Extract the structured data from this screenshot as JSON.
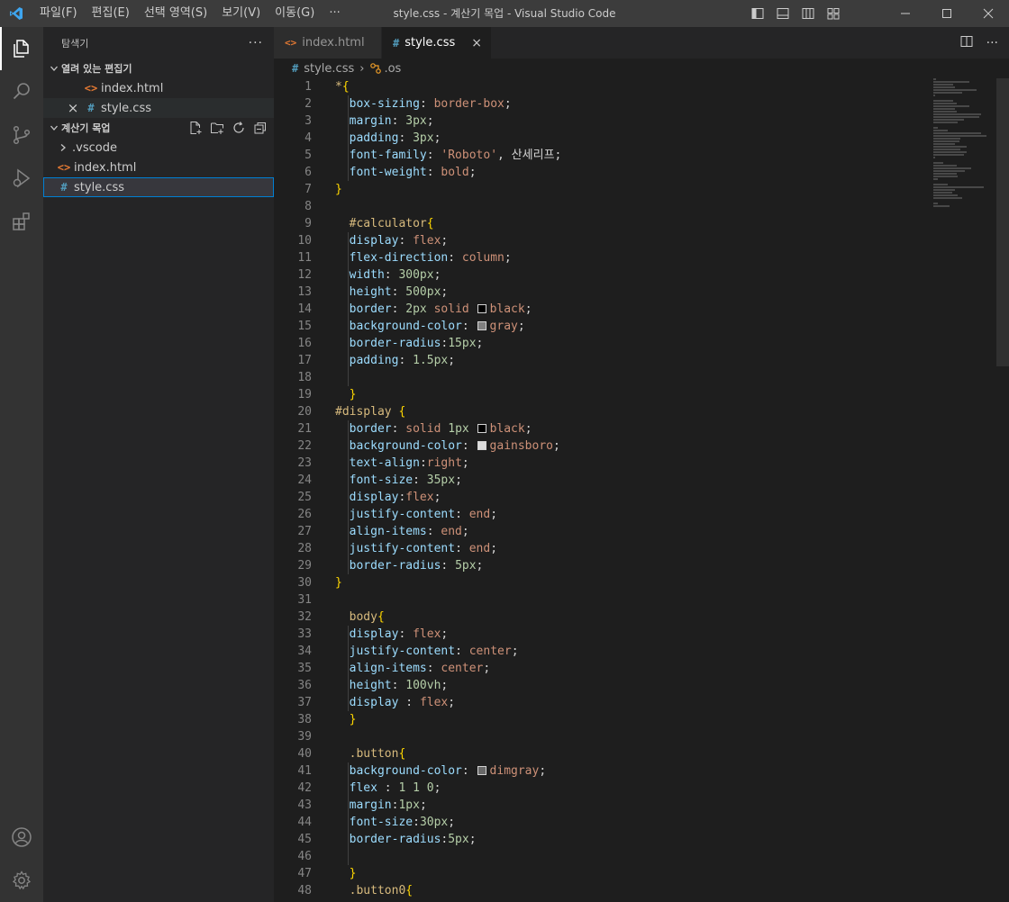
{
  "titlebar": {
    "menu": [
      "파일(F)",
      "편집(E)",
      "선택 영역(S)",
      "보기(V)",
      "이동(G)",
      "···"
    ],
    "title": "style.css - 계산기 목업 - Visual Studio Code"
  },
  "sidebar": {
    "title": "탐색기",
    "more": "···",
    "open_editors": {
      "title": "열려 있는 편집기",
      "items": [
        {
          "icon": "<>",
          "label": "index.html"
        },
        {
          "close": "×",
          "icon": "#",
          "label": "style.css"
        }
      ]
    },
    "project": {
      "title": "계산기 목업",
      "items": [
        {
          "chev": "›",
          "label": ".vscode"
        },
        {
          "icon": "<>",
          "label": "index.html"
        },
        {
          "icon": "#",
          "label": "style.css"
        }
      ]
    }
  },
  "tabs": [
    {
      "icon": "<>",
      "label": "index.html"
    },
    {
      "icon": "#",
      "label": "style.css",
      "close": "×"
    }
  ],
  "tab_actions": [
    "⫴",
    "···"
  ],
  "breadcrumb": {
    "file_icon": "#",
    "file": "style.css",
    "sep": "›",
    "symbol": ".os"
  },
  "colors": {
    "accent": "#007acc",
    "html": "#e37933",
    "css": "#519aba",
    "selector": "#d7ba7d",
    "property": "#9cdcfe",
    "value": "#ce9178",
    "number": "#b5cea8",
    "brace": "#ffd700"
  },
  "code_lines": [
    [
      [
        "tk-sel",
        "*"
      ],
      [
        "tk-brace",
        "{"
      ]
    ],
    [
      [
        "",
        "  "
      ],
      [
        "tk-prop",
        "box-sizing"
      ],
      [
        "tk-pun",
        ": "
      ],
      [
        "tk-val",
        "border-box"
      ],
      [
        "tk-pun",
        ";"
      ]
    ],
    [
      [
        "",
        "  "
      ],
      [
        "tk-prop",
        "margin"
      ],
      [
        "tk-pun",
        ": "
      ],
      [
        "tk-num",
        "3px"
      ],
      [
        "tk-pun",
        ";"
      ]
    ],
    [
      [
        "",
        "  "
      ],
      [
        "tk-prop",
        "padding"
      ],
      [
        "tk-pun",
        ": "
      ],
      [
        "tk-num",
        "3px"
      ],
      [
        "tk-pun",
        ";"
      ]
    ],
    [
      [
        "",
        "  "
      ],
      [
        "tk-prop",
        "font-family"
      ],
      [
        "tk-pun",
        ": "
      ],
      [
        "tk-val",
        "'Roboto'"
      ],
      [
        "tk-pun",
        ", 산세리프;"
      ]
    ],
    [
      [
        "",
        "  "
      ],
      [
        "tk-prop",
        "font-weight"
      ],
      [
        "tk-pun",
        ": "
      ],
      [
        "tk-val",
        "bold"
      ],
      [
        "tk-pun",
        ";"
      ]
    ],
    [
      [
        "tk-brace",
        "}"
      ]
    ],
    [],
    [
      [
        "",
        "  "
      ],
      [
        "tk-sel",
        "#calculator"
      ],
      [
        "tk-brace",
        "{"
      ]
    ],
    [
      [
        "",
        "  "
      ],
      [
        "tk-prop",
        "display"
      ],
      [
        "tk-pun",
        ": "
      ],
      [
        "tk-val",
        "flex"
      ],
      [
        "tk-pun",
        ";"
      ]
    ],
    [
      [
        "",
        "  "
      ],
      [
        "tk-prop",
        "flex-direction"
      ],
      [
        "tk-pun",
        ": "
      ],
      [
        "tk-val",
        "column"
      ],
      [
        "tk-pun",
        ";"
      ]
    ],
    [
      [
        "",
        "  "
      ],
      [
        "tk-prop",
        "width"
      ],
      [
        "tk-pun",
        ": "
      ],
      [
        "tk-num",
        "300px"
      ],
      [
        "tk-pun",
        ";"
      ]
    ],
    [
      [
        "",
        "  "
      ],
      [
        "tk-prop",
        "height"
      ],
      [
        "tk-pun",
        ": "
      ],
      [
        "tk-num",
        "500px"
      ],
      [
        "tk-pun",
        ";"
      ]
    ],
    [
      [
        "",
        "  "
      ],
      [
        "tk-prop",
        "border"
      ],
      [
        "tk-pun",
        ": "
      ],
      [
        "tk-num",
        "2px"
      ],
      [
        "tk-pun",
        " "
      ],
      [
        "tk-val",
        "solid "
      ],
      [
        "swatch",
        "#000000"
      ],
      [
        "tk-val",
        "black"
      ],
      [
        "tk-pun",
        ";"
      ]
    ],
    [
      [
        "",
        "  "
      ],
      [
        "tk-prop",
        "background-color"
      ],
      [
        "tk-pun",
        ": "
      ],
      [
        "swatch",
        "#808080"
      ],
      [
        "tk-val",
        "gray"
      ],
      [
        "tk-pun",
        ";"
      ]
    ],
    [
      [
        "",
        "  "
      ],
      [
        "tk-prop",
        "border-radius"
      ],
      [
        "tk-pun",
        ":"
      ],
      [
        "tk-num",
        "15px"
      ],
      [
        "tk-pun",
        ";"
      ]
    ],
    [
      [
        "",
        "  "
      ],
      [
        "tk-prop",
        "padding"
      ],
      [
        "tk-pun",
        ": "
      ],
      [
        "tk-num",
        "1.5px"
      ],
      [
        "tk-pun",
        ";"
      ]
    ],
    [],
    [
      [
        "",
        "  "
      ],
      [
        "tk-brace",
        "}"
      ]
    ],
    [
      [
        "tk-sel",
        "#display "
      ],
      [
        "tk-brace",
        "{"
      ]
    ],
    [
      [
        "",
        "  "
      ],
      [
        "tk-prop",
        "border"
      ],
      [
        "tk-pun",
        ": "
      ],
      [
        "tk-val",
        "solid "
      ],
      [
        "tk-num",
        "1px"
      ],
      [
        "tk-pun",
        " "
      ],
      [
        "swatch",
        "#000000"
      ],
      [
        "tk-val",
        "black"
      ],
      [
        "tk-pun",
        ";"
      ]
    ],
    [
      [
        "",
        "  "
      ],
      [
        "tk-prop",
        "background-color"
      ],
      [
        "tk-pun",
        ": "
      ],
      [
        "swatch",
        "#dcdcdc"
      ],
      [
        "tk-val",
        "gainsboro"
      ],
      [
        "tk-pun",
        ";"
      ]
    ],
    [
      [
        "",
        "  "
      ],
      [
        "tk-prop",
        "text-align"
      ],
      [
        "tk-pun",
        ":"
      ],
      [
        "tk-val",
        "right"
      ],
      [
        "tk-pun",
        ";"
      ]
    ],
    [
      [
        "",
        "  "
      ],
      [
        "tk-prop",
        "font-size"
      ],
      [
        "tk-pun",
        ": "
      ],
      [
        "tk-num",
        "35px"
      ],
      [
        "tk-pun",
        ";"
      ]
    ],
    [
      [
        "",
        "  "
      ],
      [
        "tk-prop",
        "display"
      ],
      [
        "tk-pun",
        ":"
      ],
      [
        "tk-val",
        "flex"
      ],
      [
        "tk-pun",
        ";"
      ]
    ],
    [
      [
        "",
        "  "
      ],
      [
        "tk-prop",
        "justify-content"
      ],
      [
        "tk-pun",
        ": "
      ],
      [
        "tk-val",
        "end"
      ],
      [
        "tk-pun",
        ";"
      ]
    ],
    [
      [
        "",
        "  "
      ],
      [
        "tk-prop",
        "align-items"
      ],
      [
        "tk-pun",
        ": "
      ],
      [
        "tk-val",
        "end"
      ],
      [
        "tk-pun",
        ";"
      ]
    ],
    [
      [
        "",
        "  "
      ],
      [
        "tk-prop",
        "justify-content"
      ],
      [
        "tk-pun",
        ": "
      ],
      [
        "tk-val",
        "end"
      ],
      [
        "tk-pun",
        ";"
      ]
    ],
    [
      [
        "",
        "  "
      ],
      [
        "tk-prop",
        "border-radius"
      ],
      [
        "tk-pun",
        ": "
      ],
      [
        "tk-num",
        "5px"
      ],
      [
        "tk-pun",
        ";"
      ]
    ],
    [
      [
        "tk-brace",
        "}"
      ]
    ],
    [],
    [
      [
        "",
        "  "
      ],
      [
        "tk-sel",
        "body"
      ],
      [
        "tk-brace",
        "{"
      ]
    ],
    [
      [
        "",
        "  "
      ],
      [
        "tk-prop",
        "display"
      ],
      [
        "tk-pun",
        ": "
      ],
      [
        "tk-val",
        "flex"
      ],
      [
        "tk-pun",
        ";"
      ]
    ],
    [
      [
        "",
        "  "
      ],
      [
        "tk-prop",
        "justify-content"
      ],
      [
        "tk-pun",
        ": "
      ],
      [
        "tk-val",
        "center"
      ],
      [
        "tk-pun",
        ";"
      ]
    ],
    [
      [
        "",
        "  "
      ],
      [
        "tk-prop",
        "align-items"
      ],
      [
        "tk-pun",
        ": "
      ],
      [
        "tk-val",
        "center"
      ],
      [
        "tk-pun",
        ";"
      ]
    ],
    [
      [
        "",
        "  "
      ],
      [
        "tk-prop",
        "height"
      ],
      [
        "tk-pun",
        ": "
      ],
      [
        "tk-num",
        "100vh"
      ],
      [
        "tk-pun",
        ";"
      ]
    ],
    [
      [
        "",
        "  "
      ],
      [
        "tk-prop",
        "display"
      ],
      [
        "tk-pun",
        " : "
      ],
      [
        "tk-val",
        "flex"
      ],
      [
        "tk-pun",
        ";"
      ]
    ],
    [
      [
        "",
        "  "
      ],
      [
        "tk-brace",
        "}"
      ]
    ],
    [],
    [
      [
        "",
        "  "
      ],
      [
        "tk-sel",
        ".button"
      ],
      [
        "tk-brace",
        "{"
      ]
    ],
    [
      [
        "",
        "  "
      ],
      [
        "tk-prop",
        "background-color"
      ],
      [
        "tk-pun",
        ": "
      ],
      [
        "swatch",
        "#696969"
      ],
      [
        "tk-val",
        "dimgray"
      ],
      [
        "tk-pun",
        ";"
      ]
    ],
    [
      [
        "",
        "  "
      ],
      [
        "tk-prop",
        "flex"
      ],
      [
        "tk-pun",
        " : "
      ],
      [
        "tk-num",
        "1 1 0"
      ],
      [
        "tk-pun",
        ";"
      ]
    ],
    [
      [
        "",
        "  "
      ],
      [
        "tk-prop",
        "margin"
      ],
      [
        "tk-pun",
        ":"
      ],
      [
        "tk-num",
        "1px"
      ],
      [
        "tk-pun",
        ";"
      ]
    ],
    [
      [
        "",
        "  "
      ],
      [
        "tk-prop",
        "font-size"
      ],
      [
        "tk-pun",
        ":"
      ],
      [
        "tk-num",
        "30px"
      ],
      [
        "tk-pun",
        ";"
      ]
    ],
    [
      [
        "",
        "  "
      ],
      [
        "tk-prop",
        "border-radius"
      ],
      [
        "tk-pun",
        ":"
      ],
      [
        "tk-num",
        "5px"
      ],
      [
        "tk-pun",
        ";"
      ]
    ],
    [],
    [
      [
        "",
        "  "
      ],
      [
        "tk-brace",
        "}"
      ]
    ],
    [
      [
        "",
        "  "
      ],
      [
        "tk-sel",
        ".button0"
      ],
      [
        "tk-brace",
        "{"
      ]
    ]
  ]
}
